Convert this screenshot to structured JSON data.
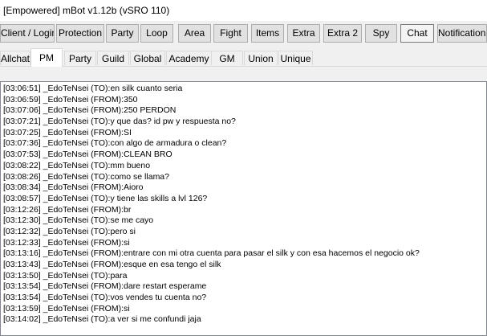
{
  "window": {
    "title": "[Empowered] mBot v1.12b (vSRO 110)"
  },
  "toolbar": {
    "buttons": [
      "Client / Login",
      "Protection",
      "Party",
      "Loop",
      "Area",
      "Fight",
      "Items",
      "Extra",
      "Extra 2",
      "Spy",
      "Chat",
      "Notifications"
    ],
    "active": "Chat"
  },
  "chat_tabs": {
    "items": [
      "Allchat",
      "PM",
      "Party",
      "Guild",
      "Global",
      "Academy",
      "GM",
      "Union",
      "Unique"
    ],
    "selected": "PM"
  },
  "log": {
    "lines": [
      "[03:06:51] _EdoTeNsei (TO):en silk cuanto seria",
      "[03:06:59] _EdoTeNsei (FROM):350",
      "[03:07:06] _EdoTeNsei (FROM):250 PERDON",
      "[03:07:21] _EdoTeNsei (TO):y que das? id pw y respuesta no?",
      "[03:07:25] _EdoTeNsei (FROM):SI",
      "[03:07:36] _EdoTeNsei (TO):con algo de armadura o clean?",
      "[03:07:53] _EdoTeNsei (FROM):CLEAN BRO",
      "[03:08:22] _EdoTeNsei (TO):mm bueno",
      "[03:08:26] _EdoTeNsei (TO):como se llama?",
      "[03:08:34] _EdoTeNsei (FROM):Aioro",
      "[03:08:57] _EdoTeNsei (TO):y tiene las skills a lvl 126?",
      "[03:12:26] _EdoTeNsei (FROM):br",
      "[03:12:30] _EdoTeNsei (TO):se me cayo",
      "[03:12:32] _EdoTeNsei (TO):pero si",
      "[03:12:33] _EdoTeNsei (FROM):si",
      "[03:13:16] _EdoTeNsei (FROM):entrare con mi otra cuenta para pasar el silk y con esa hacemos el negocio ok?",
      "[03:13:43] _EdoTeNsei (FROM):esque en esa tengo el silk",
      "[03:13:50] _EdoTeNsei (TO):para",
      "[03:13:54] _EdoTeNsei (FROM):dare restart esperame",
      "[03:13:54] _EdoTeNsei (TO):vos vendes tu cuenta no?",
      "[03:13:59] _EdoTeNsei (FROM):si",
      "[03:14:02] _EdoTeNsei (TO):a ver si me confundi jaja"
    ]
  }
}
